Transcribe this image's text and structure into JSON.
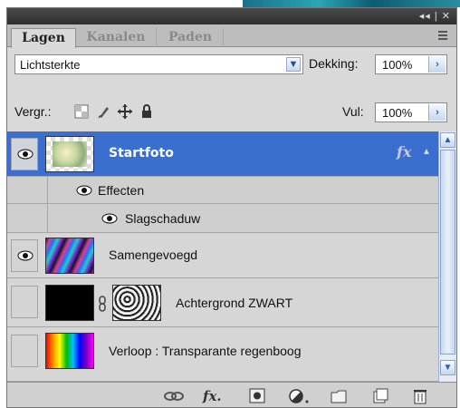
{
  "panel": {
    "tabs": [
      {
        "label": "Lagen",
        "active": true
      },
      {
        "label": "Kanalen",
        "active": false
      },
      {
        "label": "Paden",
        "active": false
      }
    ],
    "titlebar_controls": "◂◂ | ✕"
  },
  "blend_mode": {
    "value": "Lichtsterkte"
  },
  "opacity": {
    "label": "Dekking:",
    "value": "100%"
  },
  "lock": {
    "label": "Vergr.:",
    "icons": [
      "lock-transparent-icon",
      "lock-paint-icon",
      "lock-position-icon",
      "lock-all-icon"
    ]
  },
  "fill": {
    "label": "Vul:",
    "value": "100%"
  },
  "layers": [
    {
      "name": "Startfoto",
      "visible": true,
      "selected": true,
      "has_fx": true,
      "thumb": "photo"
    },
    {
      "name": "Effecten",
      "sub": true,
      "visible": true
    },
    {
      "name": "Slagschaduw",
      "sub": true,
      "visible": true
    },
    {
      "name": "Samengevoegd",
      "visible": true,
      "selected": false,
      "thumb": "colorful-streaks"
    },
    {
      "name": "Achtergrond ZWART",
      "visible": false,
      "selected": false,
      "thumb": "black",
      "has_mask": true
    },
    {
      "name": "Verloop : Transparante regenboog",
      "visible": false,
      "selected": false,
      "thumb": "rainbow"
    }
  ],
  "bottom_bar": {
    "icons": [
      "link-layers-icon",
      "fx-icon",
      "layer-mask-icon",
      "adjustment-layer-icon",
      "new-group-icon",
      "new-layer-icon",
      "trash-icon"
    ]
  },
  "colors": {
    "selection": "#3b6fcf",
    "panel_bg": "#d9d9d9"
  }
}
